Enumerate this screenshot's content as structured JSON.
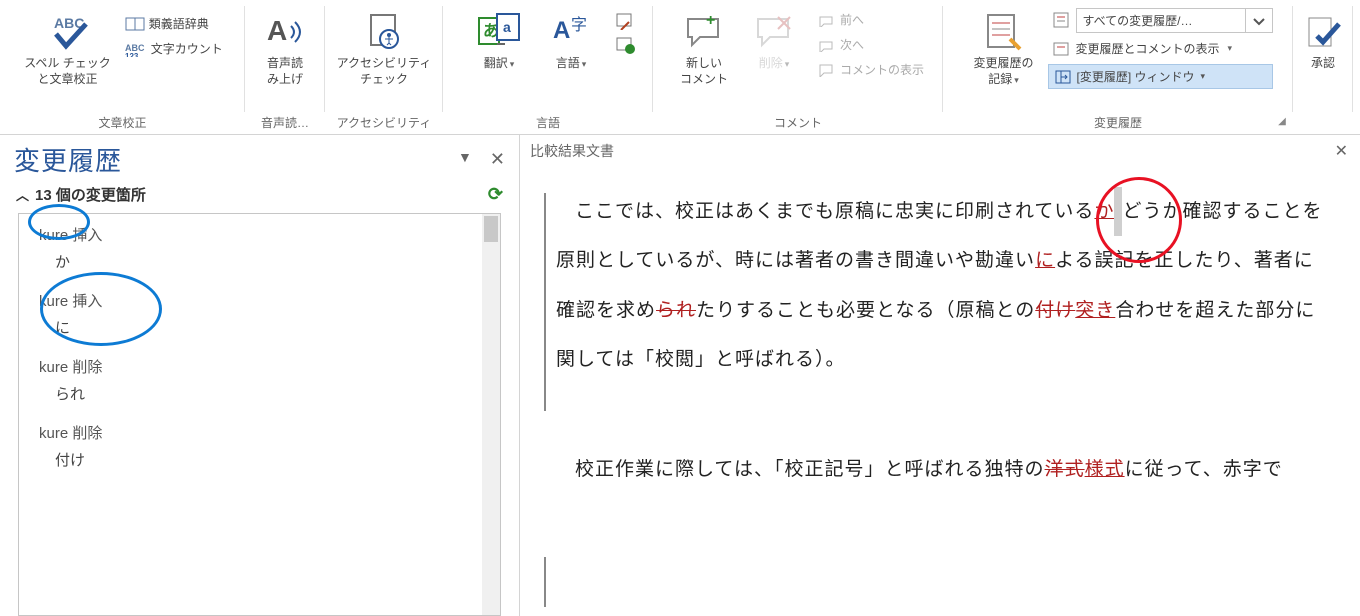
{
  "ribbon": {
    "proofing": {
      "label": "文章校正",
      "spell": "スペル チェック\nと文章校正",
      "thesaurus": "類義語辞典",
      "wordcount": "文字カウント"
    },
    "speech": {
      "label": "音声読…",
      "readaloud": "音声読\nみ上げ"
    },
    "accessibility": {
      "label": "アクセシビリティ",
      "check": "アクセシビリティ\nチェック"
    },
    "language": {
      "label": "言語",
      "translate": "翻訳",
      "language": "言語"
    },
    "comments": {
      "label": "コメント",
      "new": "新しい\nコメント",
      "delete": "削除",
      "prev": "前へ",
      "next": "次へ",
      "show": "コメントの表示"
    },
    "tracking": {
      "label": "変更履歴",
      "track": "変更履歴の\n記録",
      "markup_combo": "すべての変更履歴/…",
      "show_markup": "変更履歴とコメントの表示",
      "reviewing_pane": "[変更履歴] ウィンドウ"
    },
    "accept": {
      "label": "承認"
    }
  },
  "pane": {
    "title": "変更履歴",
    "count": "13 個の変更箇所",
    "items": [
      {
        "author": "kure 挿入",
        "content": "か"
      },
      {
        "author": "kure 挿入",
        "content": "に"
      },
      {
        "author": "kure 削除",
        "content": "られ"
      },
      {
        "author": "kure 削除",
        "content": "付け"
      }
    ]
  },
  "document": {
    "title": "比較結果文書",
    "p1_a": "ここでは、校正はあくまでも原稿に忠実に印刷されている",
    "p1_ins1": "か",
    "p1_b": "どうか確認することを原則としているが、時には著者の書き間違いや勘違い",
    "p1_ins2": "に",
    "p1_c": "よる誤記を正したり、著者に確認を求め",
    "p1_del1": "られ",
    "p1_d": "たりすることも必要となる（原稿との",
    "p1_del2": "付け",
    "p1_ins3": "突き",
    "p1_e": "合わせを超えた部分に関しては「校閲」と呼ばれる）。",
    "p2_a": "校正作業に際しては、「校正記号」と呼ばれる独特の",
    "p2_del1": "洋式",
    "p2_ins1": "様式",
    "p2_b": "に従って、赤字で"
  }
}
